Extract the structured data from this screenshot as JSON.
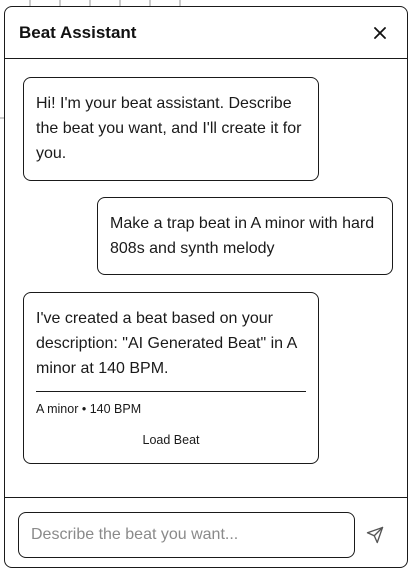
{
  "header": {
    "title": "Beat Assistant",
    "close_icon": "close-icon"
  },
  "messages": [
    {
      "role": "assistant",
      "text": "Hi! I'm your beat assistant. Describe the beat you want, and I'll create it for you."
    },
    {
      "role": "user",
      "text": "Make a trap beat in A minor with hard 808s and synth melody"
    },
    {
      "role": "assistant",
      "text": "I've created a beat based on your description: \"AI Generated Beat\" in A minor at 140 BPM.",
      "meta": "A minor • 140 BPM",
      "action_label": "Load Beat"
    }
  ],
  "composer": {
    "placeholder": "Describe the beat you want...",
    "value": "",
    "send_icon": "send-icon"
  },
  "colors": {
    "border": "#1a1a1a",
    "placeholder": "#8a8a8a",
    "background": "#ffffff"
  }
}
